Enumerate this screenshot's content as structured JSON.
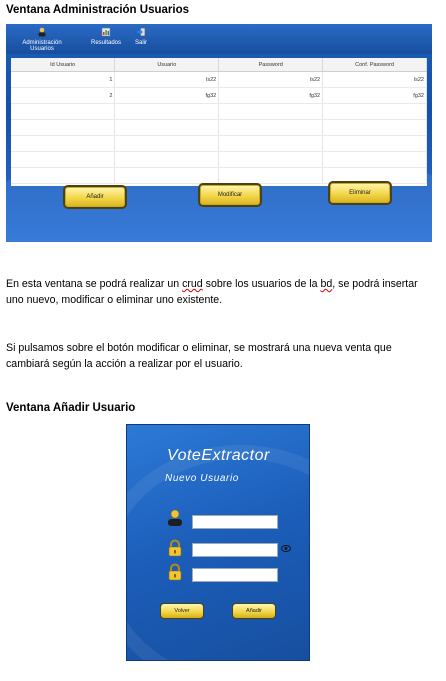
{
  "heading1": "Ventana Administración Usuarios",
  "admin_window": {
    "toolbar": [
      {
        "label": "Administración Usuarios",
        "icon": "user-admin-icon"
      },
      {
        "label": "Resultados",
        "icon": "results-icon"
      },
      {
        "label": "Salir",
        "icon": "exit-icon"
      }
    ],
    "columns": [
      "Id Usuario",
      "Usuario",
      "Password",
      "Conf. Password"
    ],
    "rows": [
      [
        "1",
        "ls22",
        "ls22",
        "ls22"
      ],
      [
        "2",
        "fg32",
        "fg32",
        "fg32"
      ]
    ],
    "buttons": {
      "add": "Añadir",
      "modify": "Modificar",
      "delete": "Eliminar"
    }
  },
  "paragraph1": {
    "a": "En esta ventana se podrá realizar un ",
    "crud": "crud",
    "b": " sobre los usuarios de la ",
    "bd": "bd",
    "c": ", se podrá insertar uno nuevo, modificar o eliminar uno existente."
  },
  "paragraph2": "Si pulsamos sobre el botón modificar o eliminar, se mostrará una nueva venta que cambiará según la acción a realizar por el usuario.",
  "heading2": "Ventana Añadir Usuario",
  "add_window": {
    "title": "VoteExtractor",
    "subtitle": "Nuevo Usuario",
    "buttons": {
      "back": "Volver",
      "add": "Añadir"
    }
  }
}
